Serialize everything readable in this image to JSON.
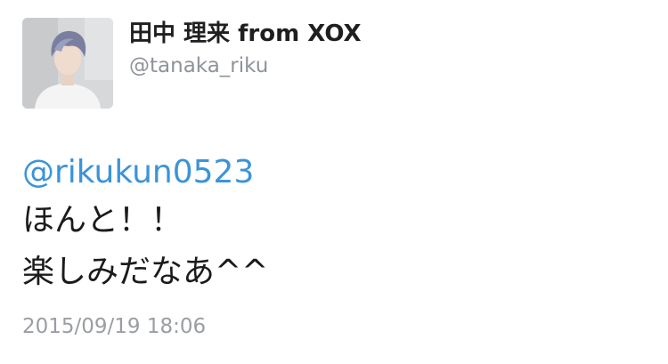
{
  "tweet": {
    "author": {
      "display_name": "田中 理来 from XOX",
      "handle": "@tanaka_riku",
      "avatar_icon": "profile-photo"
    },
    "mention": "@rikukun0523",
    "body_lines": [
      "ほんと！！",
      "楽しみだなあ^^"
    ],
    "timestamp": "2015/09/19 18:06"
  },
  "colors": {
    "mention": "#3b94d9",
    "name": "#1f1f1f",
    "handle": "#8e9399",
    "timestamp": "#9a9ea3"
  }
}
